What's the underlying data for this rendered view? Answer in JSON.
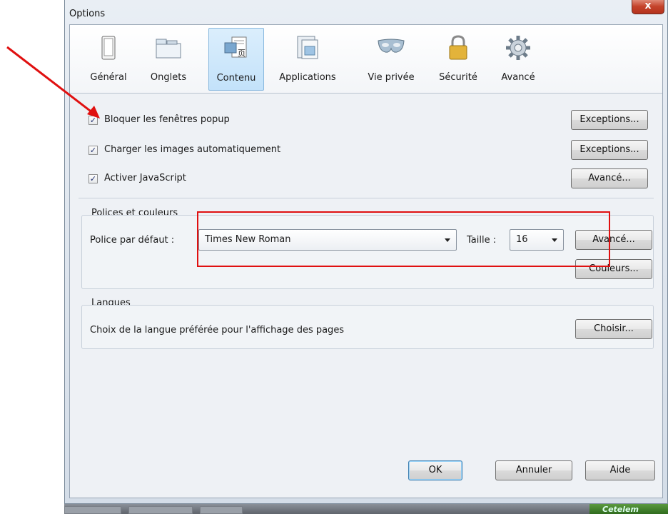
{
  "window": {
    "title": "Options",
    "close_label": "x"
  },
  "toolbar": {
    "items": [
      {
        "label": "Général",
        "icon": "general-icon"
      },
      {
        "label": "Onglets",
        "icon": "tabs-icon"
      },
      {
        "label": "Contenu",
        "icon": "content-icon",
        "selected": true
      },
      {
        "label": "Applications",
        "icon": "applications-icon"
      },
      {
        "label": "Vie privée",
        "icon": "privacy-mask-icon"
      },
      {
        "label": "Sécurité",
        "icon": "lock-icon"
      },
      {
        "label": "Avancé",
        "icon": "gear-icon"
      }
    ]
  },
  "content": {
    "popup": {
      "checked": true,
      "label": "Bloquer les fenêtres popup",
      "button": "Exceptions..."
    },
    "images": {
      "checked": true,
      "label": "Charger les images automatiquement",
      "button": "Exceptions..."
    },
    "javascript": {
      "checked": true,
      "label": "Activer JavaScript",
      "button": "Avancé..."
    }
  },
  "fonts": {
    "group_label": "Polices et couleurs",
    "default_font_label": "Police par défaut :",
    "default_font_value": "Times New Roman",
    "size_label": "Taille :",
    "size_value": "16",
    "advanced_button": "Avancé...",
    "colors_button": "Couleurs..."
  },
  "languages": {
    "group_label": "Langues",
    "description": "Choix de la langue préférée pour l'affichage des pages",
    "choose_button": "Choisir..."
  },
  "footer": {
    "ok": "OK",
    "cancel": "Annuler",
    "help": "Aide"
  },
  "taskbar": {
    "right_text": "Cetelem"
  },
  "colors": {
    "annotation": "#e01010",
    "selected_tab_bg": "#c3e2fa",
    "close_button": "#c4432b"
  }
}
